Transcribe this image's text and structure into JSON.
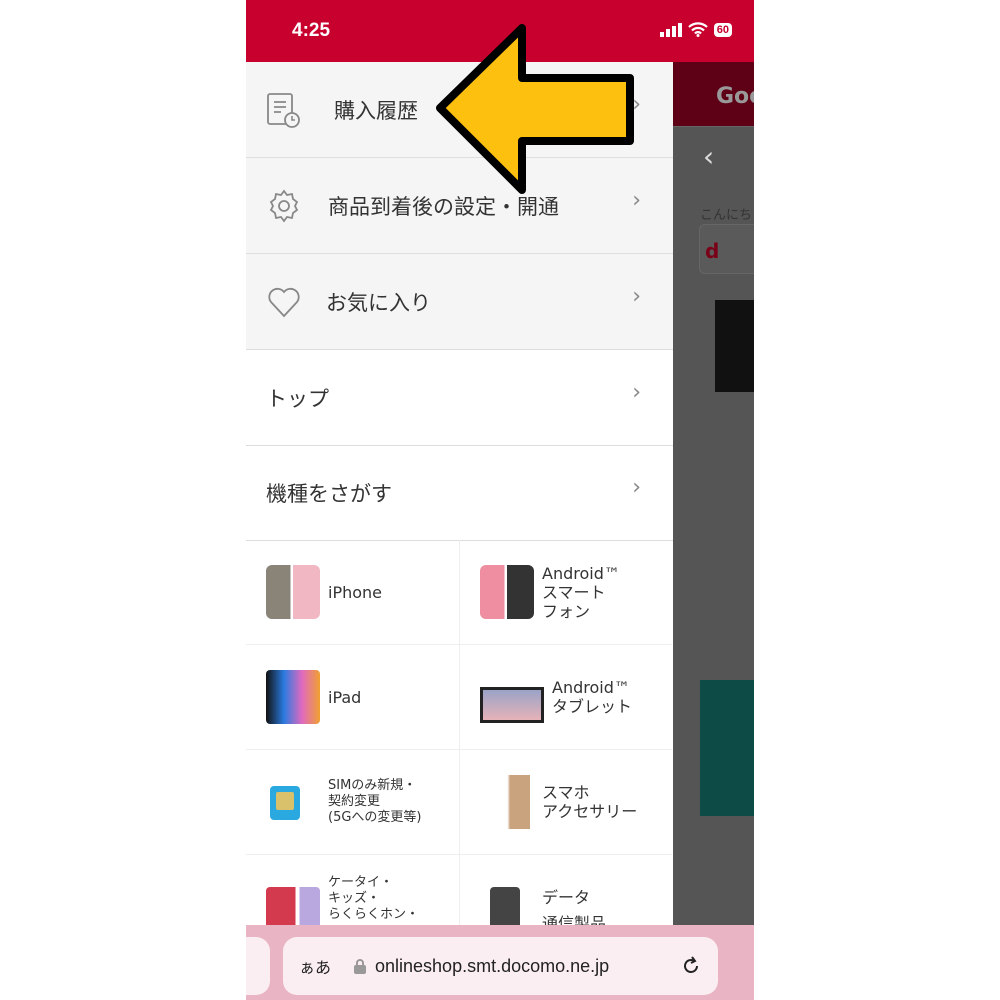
{
  "status": {
    "time": "4:25",
    "battery": "60"
  },
  "menu": {
    "items": [
      {
        "label": "購入履歴",
        "icon": "receipt-clock-icon"
      },
      {
        "label": "商品到着後の設定・開通",
        "icon": "gear-icon"
      },
      {
        "label": "お気に入り",
        "icon": "heart-icon"
      },
      {
        "label": "トップ"
      },
      {
        "label": "機種をさがす"
      }
    ],
    "categories": [
      {
        "label": "iPhone"
      },
      {
        "label": "Android™\nスマート\nフォン"
      },
      {
        "label": "iPad"
      },
      {
        "label": "Android™\nタブレット"
      },
      {
        "label": "SIMのみ新規・\n契約変更\n(5Gへの変更等)"
      },
      {
        "label": "スマホ\nアクセサリー"
      },
      {
        "label": "ケータイ・\nキッズ・\nらくらくホン・"
      },
      {
        "label": "データ\n通信製品"
      }
    ]
  },
  "background": {
    "header_text": "Goo",
    "greeting": "こんにち",
    "logo_letter": "d"
  },
  "browser": {
    "text_size": "ぁあ",
    "url": "onlineshop.smt.docomo.ne.jp"
  },
  "colors": {
    "brand": "#c8002d",
    "arrow": "#fdc00f"
  }
}
